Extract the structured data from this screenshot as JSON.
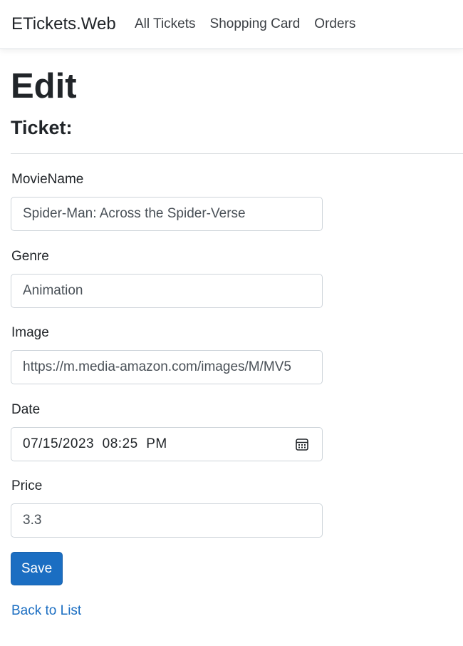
{
  "navbar": {
    "brand": "ETickets.Web",
    "links": [
      "All Tickets",
      "Shopping Card",
      "Orders"
    ]
  },
  "page": {
    "title": "Edit",
    "subtitle": "Ticket:"
  },
  "form": {
    "fields": [
      {
        "label": "MovieName",
        "value": "Spider-Man: Across the Spider-Verse"
      },
      {
        "label": "Genre",
        "value": "Animation"
      },
      {
        "label": "Image",
        "value": "https://m.media-amazon.com/images/M/MV5"
      },
      {
        "label": "Date",
        "value": "07/15/2023  08:25  PM",
        "icon": "calendar-icon"
      },
      {
        "label": "Price",
        "value": "3.3"
      }
    ],
    "save_label": "Save"
  },
  "footer": {
    "back_link": "Back to List"
  },
  "colors": {
    "primary": "#1b6ec2",
    "text": "#212529",
    "border": "#ced4da"
  }
}
